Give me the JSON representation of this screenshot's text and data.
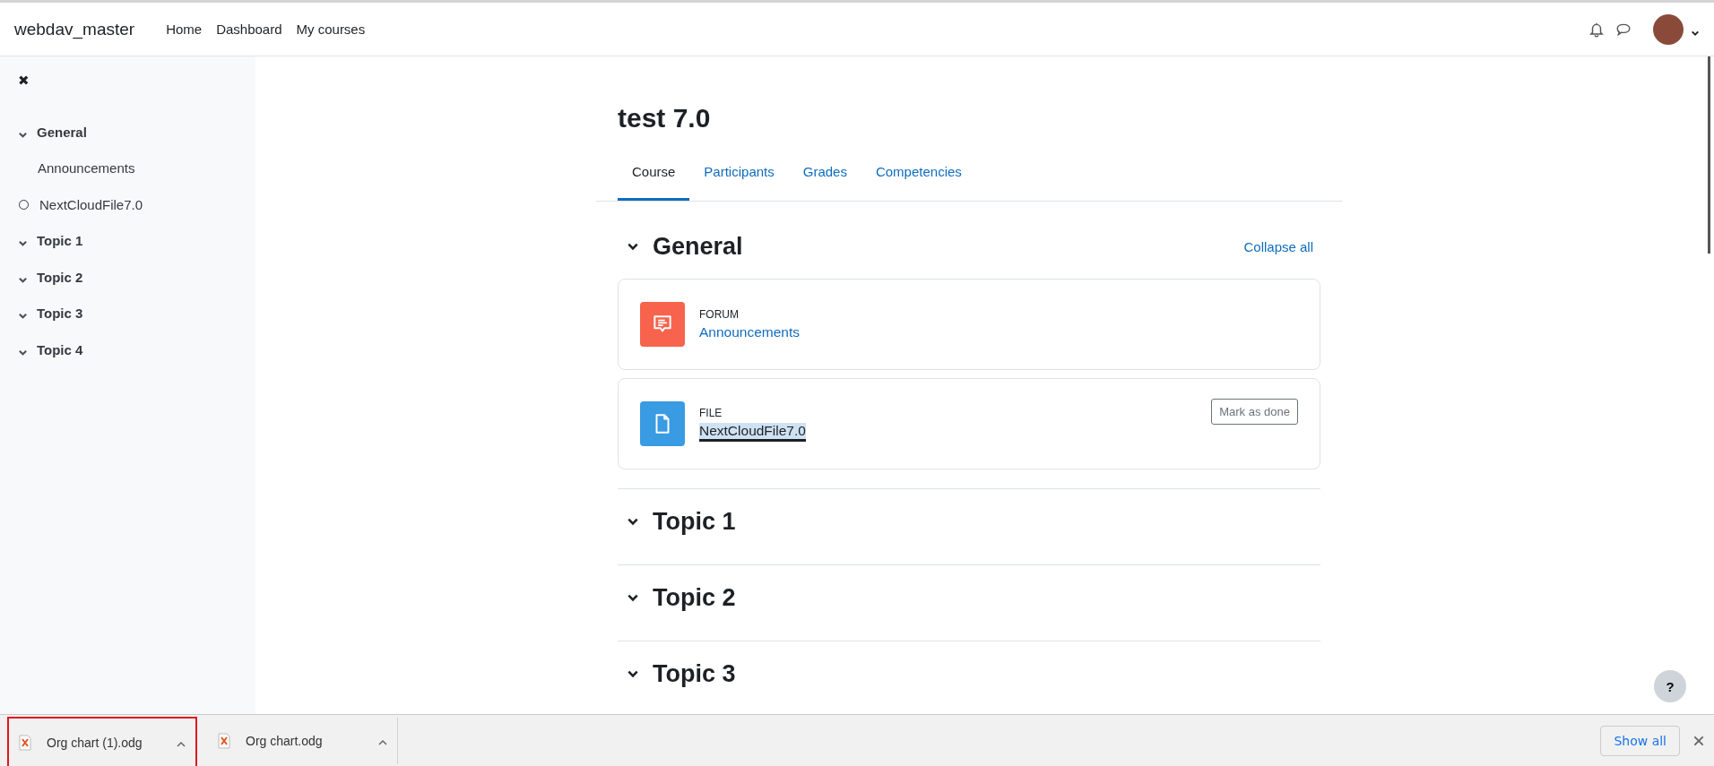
{
  "navbar": {
    "brand": "webdav_master",
    "links": [
      "Home",
      "Dashboard",
      "My courses"
    ]
  },
  "sidebar": {
    "close": "✖",
    "items": [
      {
        "label": "General",
        "expanded": true,
        "children": [
          {
            "label": "Announcements",
            "completion_tracked": false
          },
          {
            "label": "NextCloudFile7.0",
            "completion_tracked": true
          }
        ]
      },
      {
        "label": "Topic 1",
        "expanded": true
      },
      {
        "label": "Topic 2",
        "expanded": true
      },
      {
        "label": "Topic 3",
        "expanded": true
      },
      {
        "label": "Topic 4",
        "expanded": true
      }
    ]
  },
  "course": {
    "title": "test 7.0",
    "tabs": [
      {
        "label": "Course",
        "selected": true
      },
      {
        "label": "Participants",
        "selected": false
      },
      {
        "label": "Grades",
        "selected": false
      },
      {
        "label": "Competencies",
        "selected": false
      }
    ],
    "collapse_all": "Collapse all",
    "sections": [
      {
        "title": "General",
        "expanded": true,
        "activities": [
          {
            "kind": "forum",
            "type_label": "FORUM",
            "name": "Announcements",
            "focused": false
          },
          {
            "kind": "file",
            "type_label": "FILE",
            "name": "NextCloudFile7.0",
            "focused": true,
            "button": "Mark as done"
          }
        ]
      },
      {
        "title": "Topic 1",
        "expanded": true
      },
      {
        "title": "Topic 2",
        "expanded": true
      },
      {
        "title": "Topic 3",
        "expanded": true
      }
    ]
  },
  "help_button": "?",
  "downloads": {
    "items": [
      {
        "name": "Org chart (1).odg",
        "highlighted": true
      },
      {
        "name": "Org chart.odg",
        "highlighted": false
      }
    ],
    "show_all": "Show all"
  }
}
